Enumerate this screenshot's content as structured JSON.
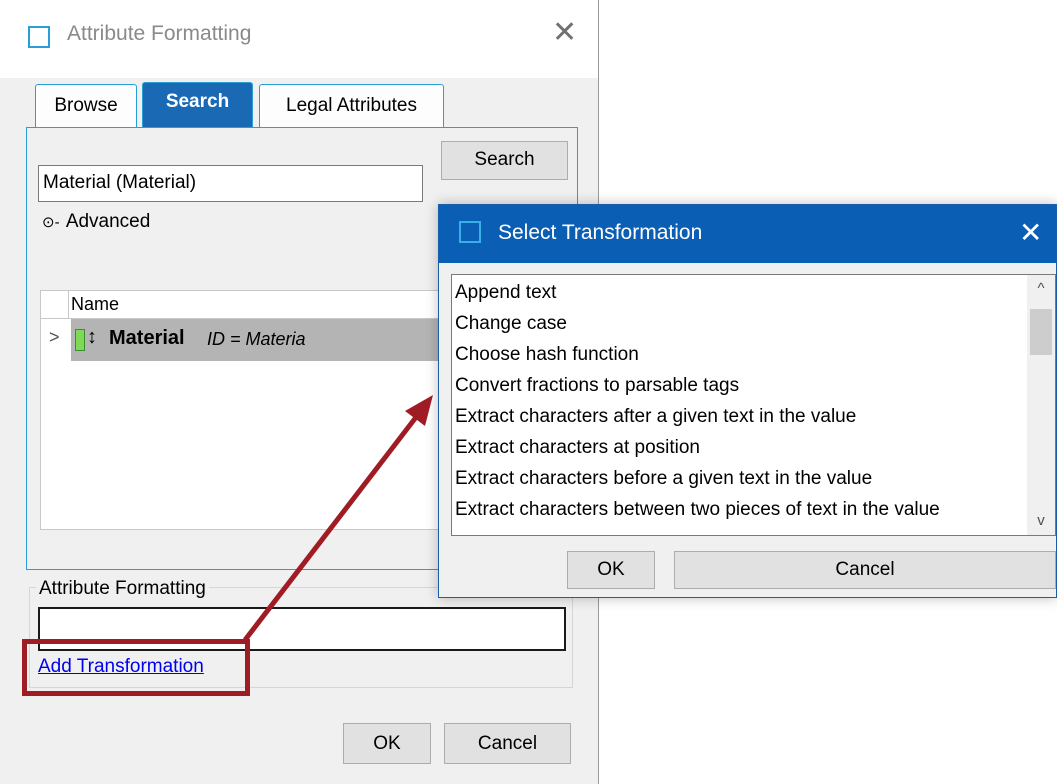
{
  "main_dialog": {
    "title": "Attribute Formatting",
    "close_glyph": "✕",
    "tabs": [
      {
        "label": "Browse"
      },
      {
        "label": "Search"
      },
      {
        "label": "Legal Attributes"
      }
    ],
    "search_button": "Search",
    "search_value": "Material (Material)",
    "advanced_label": "Advanced",
    "advanced_icon": "⊙-",
    "grid": {
      "column": "Name",
      "row": {
        "expander": ">",
        "sort_glyph": "↕",
        "name": "Material",
        "id_text": "ID = Materia"
      }
    },
    "formatting_group_label": "Attribute Formatting",
    "formatting_value": "",
    "add_transformation_link": "Add Transformation",
    "ok_label": "OK",
    "cancel_label": "Cancel"
  },
  "transform_dialog": {
    "title": "Select Transformation",
    "close_glyph": "✕",
    "items": [
      "Append text",
      "Change case",
      "Choose hash function",
      "Convert fractions to parsable tags",
      "Extract characters after a given text in the value",
      "Extract characters at position",
      "Extract characters before a given text in the value",
      "Extract characters between two pieces of text in the value"
    ],
    "scroll_up": "^",
    "scroll_down": "v",
    "ok_label": "OK",
    "cancel_label": "Cancel"
  },
  "colors": {
    "accent_blue": "#0a5fb5",
    "tab_border": "#2a9fd6",
    "highlight_red": "#a01c25",
    "link_blue": "#0000ee"
  }
}
